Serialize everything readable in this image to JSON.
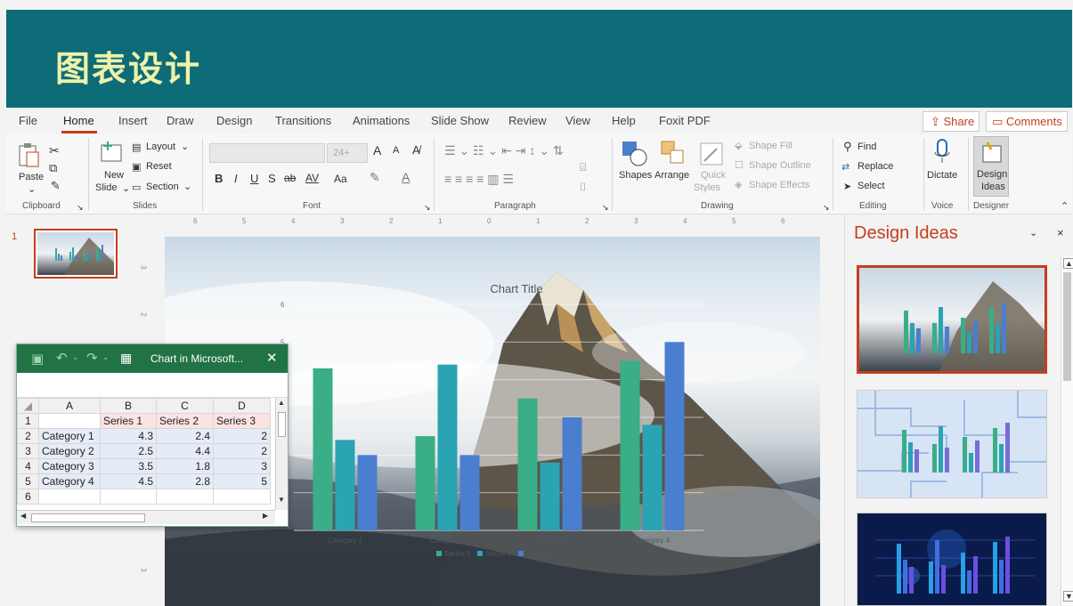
{
  "banner": {
    "title": "图表设计"
  },
  "menu": {
    "tabs": [
      "File",
      "Home",
      "Insert",
      "Draw",
      "Design",
      "Transitions",
      "Animations",
      "Slide Show",
      "Review",
      "View",
      "Help",
      "Foxit PDF"
    ],
    "active_tab": "Home",
    "share": "Share",
    "comments": "Comments"
  },
  "ribbon": {
    "clipboard": {
      "paste": "Paste",
      "label": "Clipboard"
    },
    "slides": {
      "new_slide_1": "New",
      "new_slide_2": "Slide",
      "layout": "Layout",
      "reset": "Reset",
      "section": "Section",
      "label": "Slides"
    },
    "font": {
      "size": "24+",
      "label": "Font",
      "bold": "B",
      "italic": "I",
      "underline": "U",
      "shadow": "S",
      "strike": "ab",
      "spacing": "AV",
      "case": "Aa",
      "grow": "A",
      "shrink": "A"
    },
    "paragraph": {
      "label": "Paragraph"
    },
    "drawing": {
      "shapes": "Shapes",
      "arrange": "Arrange",
      "quick_styles_1": "Quick",
      "quick_styles_2": "Styles",
      "shape_fill": "Shape Fill",
      "shape_outline": "Shape Outline",
      "shape_effects": "Shape Effects",
      "label": "Drawing"
    },
    "editing": {
      "find": "Find",
      "replace": "Replace",
      "select": "Select",
      "label": "Editing"
    },
    "voice": {
      "dictate": "Dictate",
      "label": "Voice"
    },
    "designer": {
      "design_ideas_1": "Design",
      "design_ideas_2": "Ideas",
      "label": "Designer"
    }
  },
  "ruler": {
    "ticks": [
      "6",
      "5",
      "4",
      "3",
      "2",
      "1",
      "0",
      "1",
      "2",
      "3",
      "4",
      "5",
      "6"
    ]
  },
  "vruler": {
    "ticks": [
      "3",
      "2",
      "3"
    ]
  },
  "thumbnails": {
    "slide_number": "1"
  },
  "design_pane": {
    "title": "Design Ideas"
  },
  "excel": {
    "title": "Chart in Microsoft...",
    "col_headers": [
      "A",
      "B",
      "C",
      "D"
    ],
    "row_headers": [
      "1",
      "2",
      "3",
      "4",
      "5",
      "6"
    ],
    "series_header": [
      "Series 1",
      "Series 2",
      "Series 3"
    ],
    "rows": [
      {
        "cat": "Category 1",
        "v": [
          "4.3",
          "2.4",
          "2"
        ]
      },
      {
        "cat": "Category 2",
        "v": [
          "2.5",
          "4.4",
          "2"
        ]
      },
      {
        "cat": "Category 3",
        "v": [
          "3.5",
          "1.8",
          "3"
        ]
      },
      {
        "cat": "Category 4",
        "v": [
          "4.5",
          "2.8",
          "5"
        ]
      }
    ]
  },
  "chart_data": {
    "type": "bar",
    "title": "Chart Title",
    "categories": [
      "Category 1",
      "Category 2",
      "Category 3",
      "Category 4"
    ],
    "series": [
      {
        "name": "Series 1",
        "values": [
          4.3,
          2.5,
          3.5,
          4.5
        ],
        "color": "#3aae86"
      },
      {
        "name": "Series 2",
        "values": [
          2.4,
          4.4,
          1.8,
          2.8
        ],
        "color": "#2aa3b3"
      },
      {
        "name": "Series 3",
        "values": [
          2,
          2,
          3,
          5
        ],
        "color": "#4a7fd0"
      }
    ],
    "ylim": [
      0,
      6
    ],
    "y_ticks_visible": [
      "6",
      "5"
    ],
    "grid": true,
    "legend": "bottom",
    "colors": {
      "accent": "#c43e1c",
      "excel_green": "#217346",
      "banner": "#0e6b78"
    }
  }
}
